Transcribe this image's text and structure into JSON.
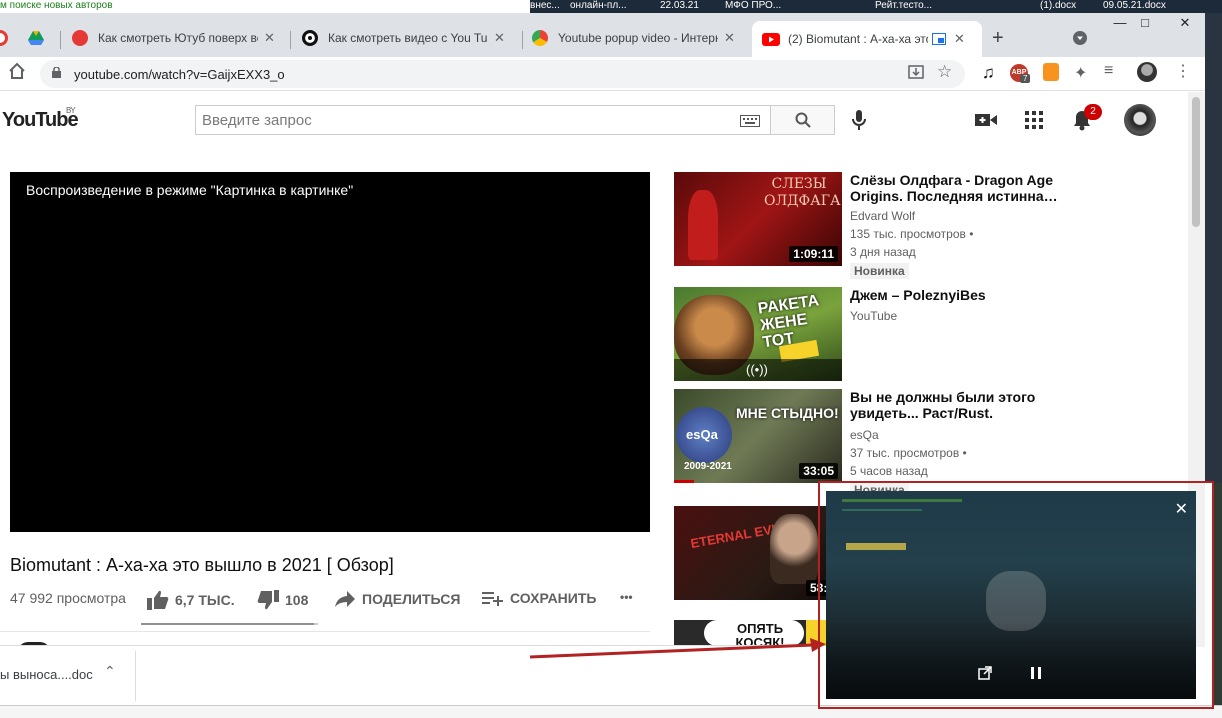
{
  "desktop": {
    "left_text": "м поиске новых авторов",
    "items": [
      "внес...",
      "онлайн-пл...",
      "22.03.21",
      "МФО ПРО...",
      "Рейт.тесто...",
      "(1).docx",
      "09.05.21.docx"
    ]
  },
  "browser": {
    "tabs": [
      {
        "title": "Как смотреть Ютуб поверх вс",
        "active": false
      },
      {
        "title": "Как смотреть видео с You Tub",
        "active": false
      },
      {
        "title": "Youtube popup video - Интерне",
        "active": false
      },
      {
        "title": "(2) Biomutant : А-ха-ха это",
        "active": true
      }
    ],
    "url": "youtube.com/watch?v=GaijxEXX3_o",
    "ext_badge": "7",
    "ext_abp": "ABP"
  },
  "youtube": {
    "logo": "YouTube",
    "region": "BY",
    "search_placeholder": "Введите запрос",
    "notif_count": "2",
    "player_message": "Воспроизведение в режиме \"Картинка в картинке\"",
    "video_title": "Biomutant : А-ха-ха это вышло в 2021 [ Обзор]",
    "views": "47 992 просмотра",
    "likes": "6,7 ТЫС.",
    "dislikes": "108",
    "share": "ПОДЕЛИТЬСЯ",
    "save": "СОХРАНИТЬ",
    "more": "•••",
    "like_ratio": 0.98
  },
  "recommendations": [
    {
      "title": "Слёзы Олдфага - Dragon Age Origins. Последняя истинна…",
      "channel": "Edvard Wolf",
      "views": "135 тыс. просмотров •",
      "age": "3 дня назад",
      "badge": "Новинка",
      "duration": "1:09:11",
      "thumb_text": "СЛЕЗЫ ОЛДФАГА"
    },
    {
      "title": "Джем – PoleznyiBes",
      "channel": "YouTube",
      "views": "",
      "age": "",
      "badge": "",
      "duration": "",
      "thumb_text": "РАКЕТА ЖЕНЕ ТОТ"
    },
    {
      "title": "Вы не должны были этого увидеть... Раст/Rust.",
      "channel": "esQa",
      "views": "37 тыс. просмотров •",
      "age": "5 часов назад",
      "badge": "Новинка",
      "duration": "33:05",
      "thumb_text": "МНЕ СТЫДНО!"
    },
    {
      "title": "",
      "channel": "",
      "views": "",
      "age": "",
      "badge": "",
      "duration": "58:1",
      "thumb_text": "ETERNAL EVIL"
    },
    {
      "title": "",
      "channel": "",
      "views": "",
      "age": "",
      "badge": "",
      "duration": "",
      "thumb_text": "ОПЯТЬ КОСЯК!"
    }
  ],
  "download": {
    "file": "ы выноса....doc"
  },
  "colors": {
    "accent_red": "#cc0000",
    "pip_border": "#b22222"
  }
}
